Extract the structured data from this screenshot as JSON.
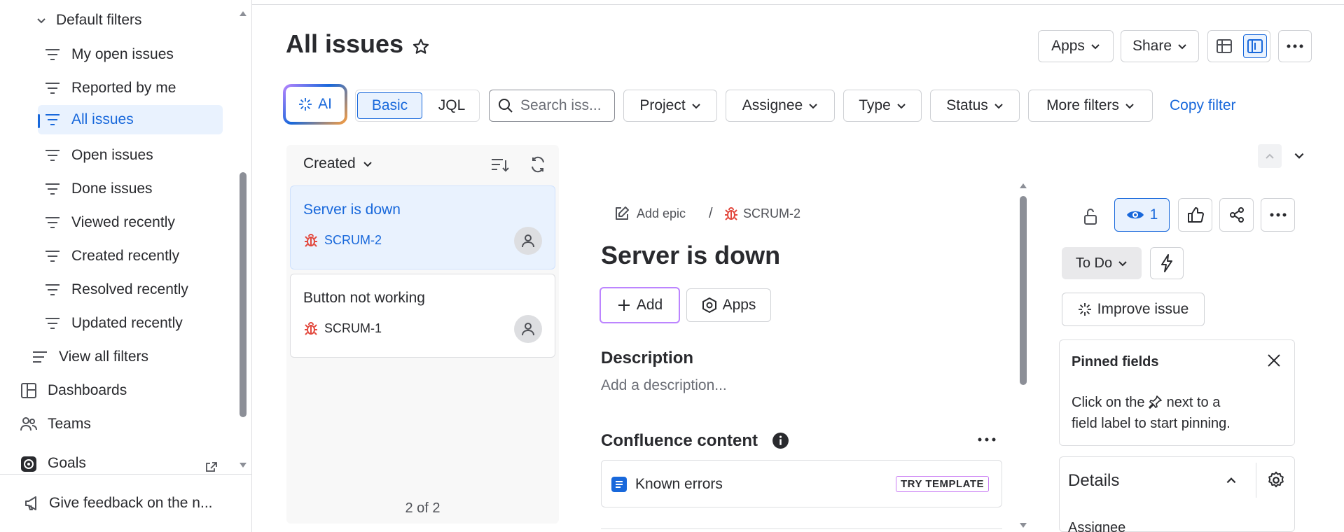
{
  "sidebar": {
    "filters_group": "Default filters",
    "items": [
      {
        "label": "My open issues"
      },
      {
        "label": "Reported by me"
      },
      {
        "label": "All issues"
      },
      {
        "label": "Open issues"
      },
      {
        "label": "Done issues"
      },
      {
        "label": "Viewed recently"
      },
      {
        "label": "Created recently"
      },
      {
        "label": "Resolved recently"
      },
      {
        "label": "Updated recently"
      }
    ],
    "view_all": "View all filters",
    "dashboards": "Dashboards",
    "teams": "Teams",
    "goals": "Goals",
    "feedback": "Give feedback on the n..."
  },
  "header": {
    "title": "All issues",
    "apps": "Apps",
    "share": "Share"
  },
  "filters": {
    "ai": "AI",
    "basic": "Basic",
    "jql": "JQL",
    "search_placeholder": "Search iss...",
    "project": "Project",
    "assignee": "Assignee",
    "type": "Type",
    "status": "Status",
    "more": "More filters",
    "copy": "Copy filter"
  },
  "list": {
    "sort_label": "Created",
    "cards": [
      {
        "title": "Server is down",
        "key": "SCRUM-2"
      },
      {
        "title": "Button not working",
        "key": "SCRUM-1"
      }
    ],
    "count": "2 of 2"
  },
  "issue": {
    "add_epic": "Add epic",
    "separator": "/",
    "key": "SCRUM-2",
    "title": "Server is down",
    "add": "Add",
    "apps": "Apps",
    "description_heading": "Description",
    "description_placeholder": "Add a description...",
    "confluence_heading": "Confluence content",
    "confluence_item": "Known errors",
    "try_template": "TRY TEMPLATE"
  },
  "side": {
    "watch_count": "1",
    "status": "To Do",
    "improve": "Improve issue",
    "pinned_title": "Pinned fields",
    "pinned_text_1": "Click on the",
    "pinned_text_2": "next to a",
    "pinned_text_3": "field label to start pinning.",
    "details": "Details",
    "assignee": "Assignee"
  },
  "colors": {
    "accent": "#1868db",
    "bug": "#e2483d",
    "selected_bg": "#e9f2fe",
    "add_border": "#bc85ff",
    "template_border": "#c97cf4"
  }
}
